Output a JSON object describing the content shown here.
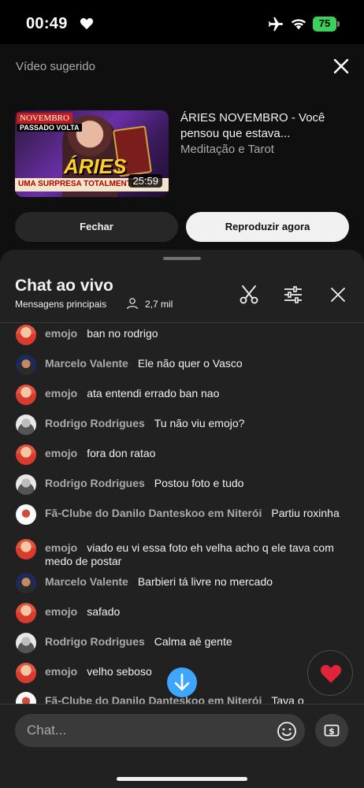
{
  "status_bar": {
    "time": "00:49",
    "battery": "75"
  },
  "suggest": {
    "heading": "Vídeo sugerido",
    "video_title": "ÁRIES NOVEMBRO - Você pensou que estava...",
    "channel": "Meditação e Tarot",
    "duration": "25:59",
    "thumb_badge_top": "NOVEMBRO",
    "thumb_badge_sub": "PASSADO VOLTA",
    "thumb_sign": "ÁRIES",
    "thumb_banner": "UMA SURPRESA TOTALMENTE IN",
    "close_label": "Fechar",
    "play_label": "Reproduzir agora"
  },
  "chat": {
    "title": "Chat ao vivo",
    "mode": "Mensagens principais",
    "viewers": "2,7 mil",
    "input_placeholder": "Chat...",
    "messages": [
      {
        "author": "emojo",
        "text": "ban no rodrigo",
        "avatar": "emojo"
      },
      {
        "author": "Marcelo Valente",
        "text": "Ele não quer o Vasco",
        "avatar": "marcelo"
      },
      {
        "author": "emojo",
        "text": "ata entendi errado ban nao",
        "avatar": "emojo"
      },
      {
        "author": "Rodrigo Rodrigues",
        "text": "Tu não viu emojo?",
        "avatar": "rodrigo"
      },
      {
        "author": "emojo",
        "text": "fora don ratao",
        "avatar": "emojo"
      },
      {
        "author": "Rodrigo Rodrigues",
        "text": "Postou foto e tudo",
        "avatar": "rodrigo"
      },
      {
        "author": "Fã-Clube do Danilo Danteskoo em Niterói",
        "text": "Partiu roxinha",
        "avatar": "fa"
      },
      {
        "author": "emojo",
        "text": "viado eu vi essa foto eh velha acho q ele tava com medo de postar",
        "avatar": "emojo"
      },
      {
        "author": "Marcelo Valente",
        "text": "Barbieri tá livre no mercado",
        "avatar": "marcelo"
      },
      {
        "author": "emojo",
        "text": "safado",
        "avatar": "emojo"
      },
      {
        "author": "Rodrigo Rodrigues",
        "text": "Calma aê gente",
        "avatar": "rodrigo"
      },
      {
        "author": "emojo",
        "text": "velho seboso",
        "avatar": "emojo"
      },
      {
        "author": "Fã-Clube do Danilo Danteskoo em Niterói",
        "text": "Tava o",
        "avatar": "fa"
      }
    ]
  },
  "colors": {
    "accent_blue": "#3ea6ff",
    "heart_red": "#e0243a",
    "battery_green": "#3bd05a"
  }
}
